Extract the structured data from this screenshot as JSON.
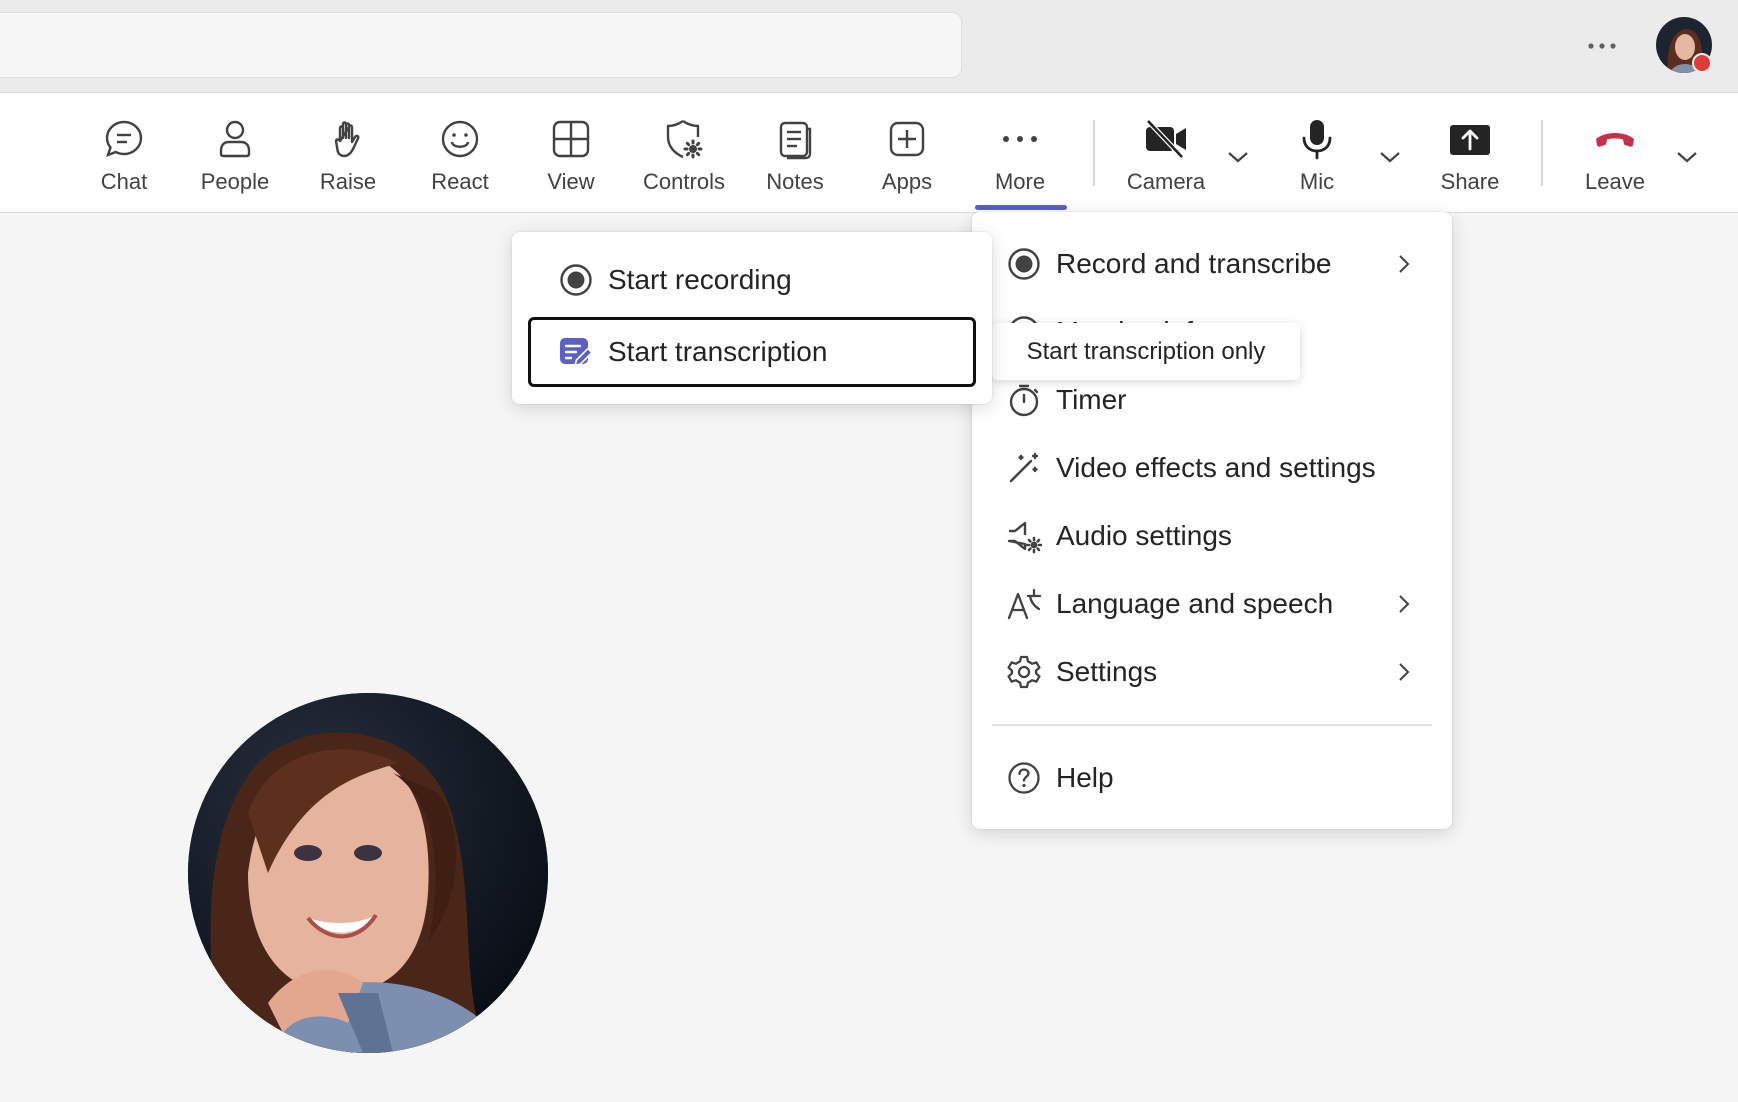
{
  "titlebar": {
    "more_icon": "ellipsis-icon",
    "status_color": "#e03b3b"
  },
  "toolbar": {
    "chat": "Chat",
    "people": "People",
    "raise": "Raise",
    "react": "React",
    "view": "View",
    "controls": "Controls",
    "notes": "Notes",
    "apps": "Apps",
    "more": "More",
    "camera": "Camera",
    "mic": "Mic",
    "share": "Share",
    "leave": "Leave",
    "accent": "#5b5fc7",
    "leave_color": "#c4314b"
  },
  "more_menu": {
    "items": [
      {
        "label": "Record and transcribe",
        "icon": "record-icon",
        "has_submenu": true
      },
      {
        "label": "Meeting info",
        "icon": "info-icon",
        "has_submenu": false
      },
      {
        "label": "Timer",
        "icon": "timer-icon",
        "has_submenu": false
      },
      {
        "label": "Video effects and settings",
        "icon": "wand-icon",
        "has_submenu": false
      },
      {
        "label": "Audio settings",
        "icon": "speaker-gear-icon",
        "has_submenu": false
      },
      {
        "label": "Language and speech",
        "icon": "language-icon",
        "has_submenu": true
      },
      {
        "label": "Settings",
        "icon": "gear-icon",
        "has_submenu": true
      },
      {
        "label": "Help",
        "icon": "help-icon",
        "has_submenu": false
      }
    ]
  },
  "record_submenu": {
    "items": [
      {
        "label": "Start recording",
        "icon": "record-icon"
      },
      {
        "label": "Start transcription",
        "icon": "transcription-icon"
      }
    ]
  },
  "tooltip": {
    "text": "Start transcription only"
  }
}
